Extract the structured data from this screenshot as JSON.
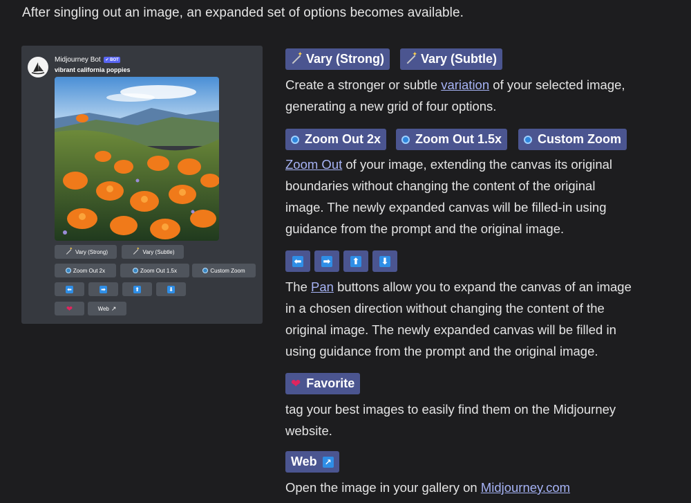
{
  "intro": "After singling out an image, an expanded set of options becomes available.",
  "card": {
    "bot_name": "Midjourney Bot",
    "bot_badge": "✔ BOT",
    "prompt": "vibrant california poppies",
    "buttons": {
      "vary_strong": "Vary (Strong)",
      "vary_subtle": "Vary (Subtle)",
      "zoom_out_2x": "Zoom Out 2x",
      "zoom_out_15x": "Zoom Out 1.5x",
      "custom_zoom": "Custom Zoom",
      "web": "Web"
    },
    "arrows": [
      "⬅",
      "➡",
      "⬆",
      "⬇"
    ]
  },
  "sections": {
    "vary": {
      "strong_label": "Vary (Strong)",
      "subtle_label": "Vary (Subtle)",
      "text_before": "Create a stronger or subtle ",
      "link": "variation",
      "text_after_line1": " of your selected image,",
      "line2": "generating a new grid of four options."
    },
    "zoom": {
      "zoom_2x": "Zoom Out 2x",
      "zoom_15x": "Zoom Out 1.5x",
      "custom": "Custom Zoom",
      "link": "Zoom Out",
      "line1_after": " of your image, extending the canvas its original",
      "line2": "boundaries without changing the content of the original",
      "line3": "image. The newly expanded canvas will be filled-in using",
      "line4": "guidance from the prompt and the original image."
    },
    "pan": {
      "arrows": [
        "⬅",
        "➡",
        "⬆",
        "⬇"
      ],
      "line1_before": "The ",
      "link": "Pan",
      "line1_after": " buttons allow you to expand the canvas of an image",
      "line2": "in a chosen direction without changing the content of the",
      "line3": "original image. The newly expanded canvas will be filled in",
      "line4": "using guidance from the prompt and the original image."
    },
    "favorite": {
      "label": "Favorite",
      "line1": "tag your best images to easily find them on the Midjourney",
      "line2": "website."
    },
    "web": {
      "label": "Web",
      "text_before": "Open the image in your gallery on ",
      "link": "Midjourney.com"
    }
  },
  "colors": {
    "background": "#1d1d1f",
    "card": "#36393f",
    "pill": "#4b5590",
    "link": "#a6b3f5",
    "arrow_blue": "#2f8ee6"
  }
}
